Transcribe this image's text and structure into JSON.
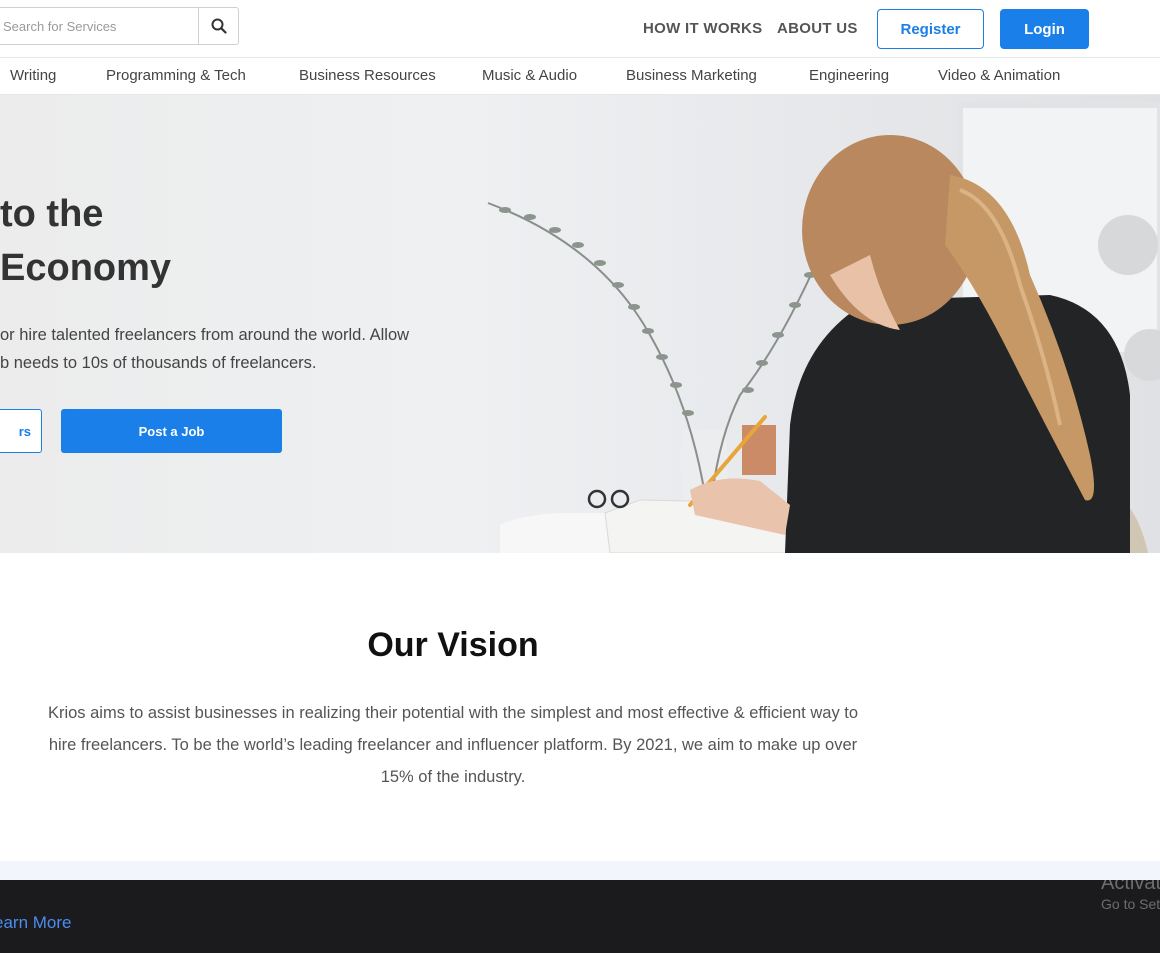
{
  "header": {
    "search": {
      "placeholder": "Search for Services",
      "value": ""
    },
    "nav": [
      {
        "label": "HOW IT WORKS"
      },
      {
        "label": "ABOUT US"
      }
    ],
    "register_label": "Register",
    "login_label": "Login"
  },
  "categories": [
    "Writing",
    "Programming & Tech",
    "Business Resources",
    "Music & Audio",
    "Business Marketing",
    "Engineering",
    "Video & Animation"
  ],
  "hero": {
    "title_line1": "to the",
    "title_line2": "Economy",
    "text_line1": "or hire talented freelancers from around the world. Allow",
    "text_line2": "b needs to 10s of thousands of freelancers.",
    "find_label": "rs",
    "post_label": "Post a Job"
  },
  "vision": {
    "title": "Our Vision",
    "text": "Krios aims to assist businesses in realizing their potential with the simplest and most effective & efficient way to hire freelancers. To be the world’s leading freelancer and influencer platform. By 2021, we aim to make up over 15% of the industry."
  },
  "footer": {
    "learn_more": "earn More",
    "activate_title": "Activat",
    "activate_sub": "Go to Set"
  },
  "colors": {
    "accent": "#1a7fe8",
    "footer_bg": "#1b1b1d",
    "link": "#4a8cf0"
  }
}
